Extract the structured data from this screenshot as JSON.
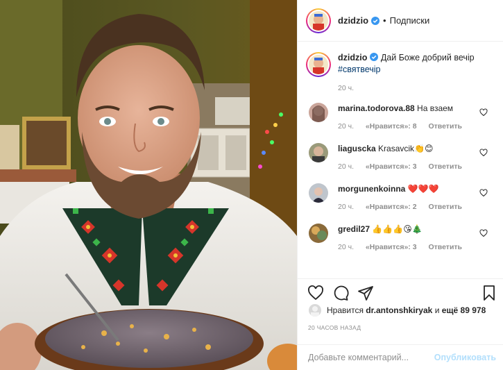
{
  "post": {
    "username": "dzidzio",
    "follow_label": "Подписки",
    "separator": "•",
    "caption_text": "Дай Боже добрий вечір",
    "caption_hashtag": "#святвечір",
    "caption_time": "20 ч."
  },
  "comments": [
    {
      "user": "marina.todorova.88",
      "text": "На взаем",
      "time": "20 ч.",
      "likes": "«Нравится»: 8",
      "reply": "Ответить"
    },
    {
      "user": "liaguscka",
      "text": "Krasavcik👏😊",
      "time": "20 ч.",
      "likes": "«Нравится»: 3",
      "reply": "Ответить"
    },
    {
      "user": "morgunenkoinna",
      "text": "❤️❤️❤️",
      "time": "20 ч.",
      "likes": "«Нравится»: 2",
      "reply": "Ответить"
    },
    {
      "user": "gredil27",
      "text": "👍👍👍😘🎄",
      "time": "20 ч.",
      "likes": "«Нравится»: 3",
      "reply": "Ответить"
    }
  ],
  "likes_bar": {
    "prefix": "Нравится",
    "liker": "dr.antonshkiryak",
    "mid": "и",
    "rest": "ещё 89 978"
  },
  "time_ago": "20 ЧАСОВ НАЗАД",
  "add_comment": {
    "placeholder": "Добавьте комментарий...",
    "publish": "Опубликовать"
  },
  "icons": {
    "like": "heart-icon",
    "comment": "comment-icon",
    "share": "share-icon",
    "save": "bookmark-icon",
    "verified": "verified-badge-icon"
  },
  "colors": {
    "verified": "#3897f0",
    "hashtag": "#00376b",
    "muted": "#8e8e8e",
    "publish": "#b2dffc"
  }
}
